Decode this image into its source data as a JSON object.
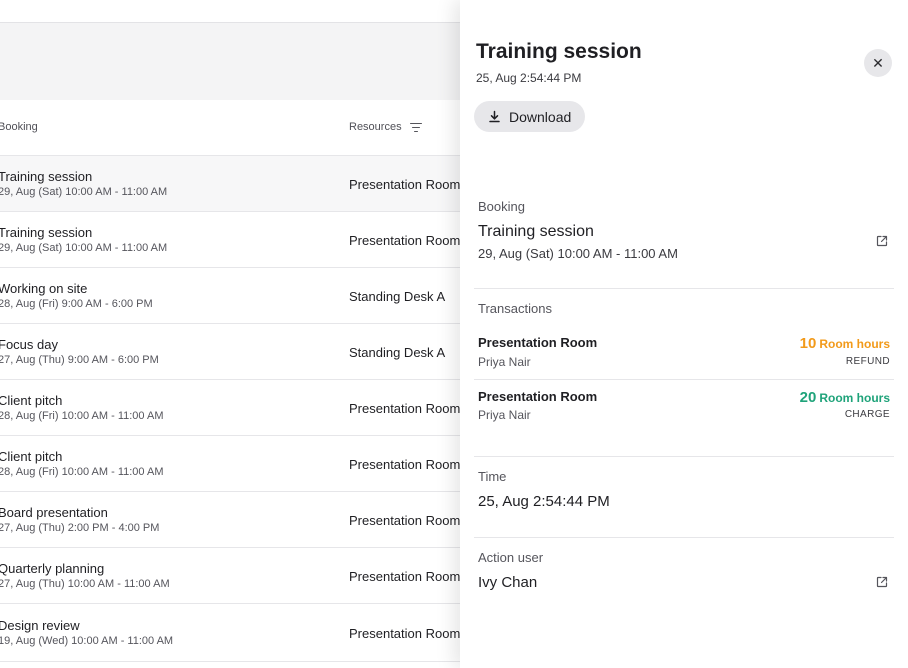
{
  "table": {
    "headers": {
      "booking": "Booking",
      "resources": "Resources"
    },
    "rows": [
      {
        "title": "Training session",
        "date": "29, Aug (Sat) 10:00 AM - 11:00 AM",
        "resource": "Presentation Room"
      },
      {
        "title": "Training session",
        "date": "29, Aug (Sat) 10:00 AM - 11:00 AM",
        "resource": "Presentation Room"
      },
      {
        "title": "Working on site",
        "date": "28, Aug (Fri) 9:00 AM - 6:00 PM",
        "resource": "Standing Desk A"
      },
      {
        "title": "Focus day",
        "date": "27, Aug (Thu) 9:00 AM - 6:00 PM",
        "resource": "Standing Desk A"
      },
      {
        "title": "Client pitch",
        "date": "28, Aug (Fri) 10:00 AM - 11:00 AM",
        "resource": "Presentation Room"
      },
      {
        "title": "Client pitch",
        "date": "28, Aug (Fri) 10:00 AM - 11:00 AM",
        "resource": "Presentation Room"
      },
      {
        "title": "Board presentation",
        "date": "27, Aug (Thu) 2:00 PM - 4:00 PM",
        "resource": "Presentation Room"
      },
      {
        "title": "Quarterly planning",
        "date": "27, Aug (Thu) 10:00 AM - 11:00 AM",
        "resource": "Presentation Room"
      },
      {
        "title": "Design review",
        "date": "19, Aug (Wed) 10:00 AM - 11:00 AM",
        "resource": "Presentation Room"
      }
    ]
  },
  "panel": {
    "title": "Training session",
    "timestamp": "25, Aug 2:54:44 PM",
    "close_symbol": "✕",
    "download_label": "Download",
    "booking": {
      "label": "Booking",
      "title": "Training session",
      "date": "29, Aug (Sat) 10:00 AM - 11:00 AM"
    },
    "transactions": {
      "label": "Transactions",
      "items": [
        {
          "resource": "Presentation Room",
          "user": "Priya Nair",
          "amount": "10",
          "unit": "Room hours",
          "type": "REFUND",
          "color": "#f29a1a"
        },
        {
          "resource": "Presentation Room",
          "user": "Priya Nair",
          "amount": "20",
          "unit": "Room hours",
          "type": "CHARGE",
          "color": "#1fa37a"
        }
      ]
    },
    "time": {
      "label": "Time",
      "value": "25, Aug 2:54:44 PM"
    },
    "action_user": {
      "label": "Action user",
      "value": "Ivy Chan"
    }
  },
  "icons": {
    "filter": "filter-icon",
    "close": "close-icon",
    "download": "download-icon",
    "external_link": "external-link-icon"
  },
  "colors": {
    "refund": "#f29a1a",
    "charge": "#1fa37a"
  }
}
